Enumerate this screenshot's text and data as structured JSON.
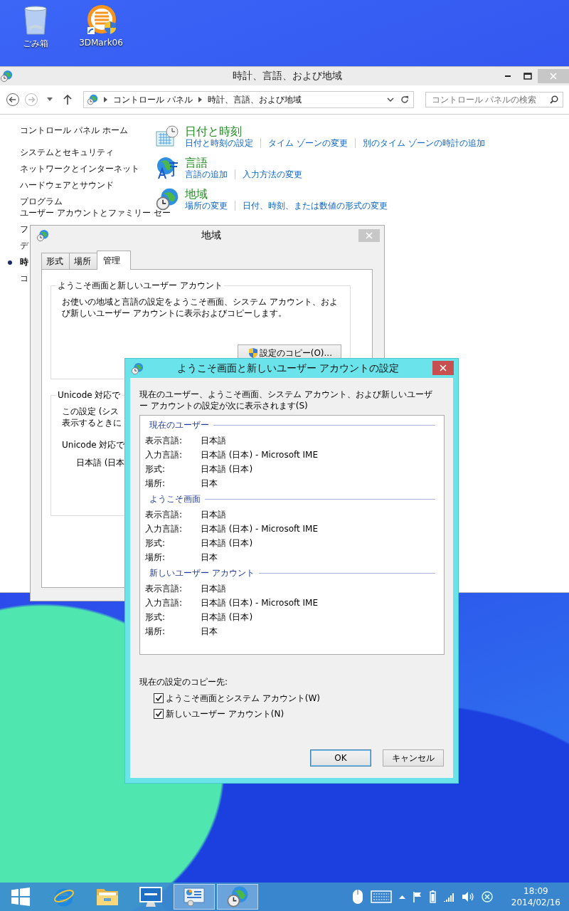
{
  "desktop_icons": [
    {
      "kind": "recycle-bin",
      "label": "ごみ箱"
    },
    {
      "kind": "app-shortcut",
      "label": "3DMark06"
    }
  ],
  "control_panel": {
    "title": "時計、言語、および地域",
    "breadcrumb": [
      "コントロール パネル",
      "時計、言語、および地域"
    ],
    "search": {
      "placeholder": "コントロール パネルの検索"
    },
    "sidebar": {
      "home": "コントロール パネル ホーム",
      "items": [
        {
          "label": "システムとセキュリティ",
          "selected": false
        },
        {
          "label": "ネットワークとインターネット",
          "selected": false
        },
        {
          "label": "ハードウェアとサウンド",
          "selected": false
        },
        {
          "label": "プログラム",
          "selected": false
        },
        {
          "label": "ユーザー アカウントとファミリー セー",
          "selected": false
        },
        {
          "label": "フ",
          "selected": false
        },
        {
          "label": "デ",
          "selected": false
        },
        {
          "label": "時",
          "selected": true
        },
        {
          "label": "コ",
          "selected": false
        }
      ]
    },
    "categories": [
      {
        "kind": "datetime",
        "title": "日付と時刻",
        "links": [
          "日付と時刻の設定",
          "タイム ゾーンの変更",
          "別のタイム ゾーンの時計の追加"
        ]
      },
      {
        "kind": "language",
        "title": "言語",
        "links": [
          "言語の追加",
          "入力方法の変更"
        ]
      },
      {
        "kind": "region",
        "title": "地域",
        "links": [
          "場所の変更",
          "日付、時刻、または数値の形式の変更"
        ]
      }
    ]
  },
  "region_dialog": {
    "title": "地域",
    "tabs": [
      {
        "label": "形式",
        "selected": false
      },
      {
        "label": "場所",
        "selected": false
      },
      {
        "label": "管理",
        "selected": true
      }
    ],
    "welcome_group": {
      "title": "ようこそ画面と新しいユーザー アカウント",
      "description": "お使いの地域と言語の設定をようこそ画面、システム アカウント、および新しいユーザー アカウントに表示およびコピーします。",
      "button": "設定のコピー(O)..."
    },
    "unicode_group": {
      "title": "Unicode 対応で",
      "description_lines": [
        "この設定 (シス",
        "表示するときに"
      ],
      "label": "Unicode 対応で",
      "value": "日本語 (日本"
    }
  },
  "welcome_dialog": {
    "title": "ようこそ画面と新しいユーザー アカウントの設定",
    "description": "現在のユーザー、ようこそ画面、システム アカウント、および新しいユーザー アカウントの設定が次に表示されます(S)",
    "sections": [
      {
        "title": "現在のユーザー",
        "rows": [
          {
            "label": "表示言語:",
            "value": "日本語"
          },
          {
            "label": "入力言語:",
            "value": "日本語 (日本) - Microsoft IME"
          },
          {
            "label": "形式:",
            "value": "日本語 (日本)"
          },
          {
            "label": "場所:",
            "value": "日本"
          }
        ]
      },
      {
        "title": "ようこそ画面",
        "rows": [
          {
            "label": "表示言語:",
            "value": "日本語"
          },
          {
            "label": "入力言語:",
            "value": "日本語 (日本) - Microsoft IME"
          },
          {
            "label": "形式:",
            "value": "日本語 (日本)"
          },
          {
            "label": "場所:",
            "value": "日本"
          }
        ]
      },
      {
        "title": "新しいユーザー アカウント",
        "rows": [
          {
            "label": "表示言語:",
            "value": "日本語"
          },
          {
            "label": "入力言語:",
            "value": "日本語 (日本) - Microsoft IME"
          },
          {
            "label": "形式:",
            "value": "日本語 (日本)"
          },
          {
            "label": "場所:",
            "value": "日本"
          }
        ]
      }
    ],
    "copy_to_label": "現在の設定のコピー先:",
    "checkboxes": [
      {
        "label": "ようこそ画面とシステム アカウント(W)",
        "checked": true
      },
      {
        "label": "新しいユーザー アカウント(N)",
        "checked": true
      }
    ],
    "buttons": [
      {
        "label": "OK",
        "default": true
      },
      {
        "label": "キャンセル",
        "default": false
      }
    ]
  },
  "taskbar": {
    "apps": [
      {
        "kind": "start",
        "active": false
      },
      {
        "kind": "browser",
        "active": false
      },
      {
        "kind": "folder",
        "active": false
      },
      {
        "kind": "monitor",
        "active": false
      },
      {
        "kind": "control-panel",
        "active": true
      },
      {
        "kind": "globe-clock",
        "active": true
      }
    ],
    "clock": {
      "time": "18:09",
      "date": "2014/02/16"
    }
  }
}
